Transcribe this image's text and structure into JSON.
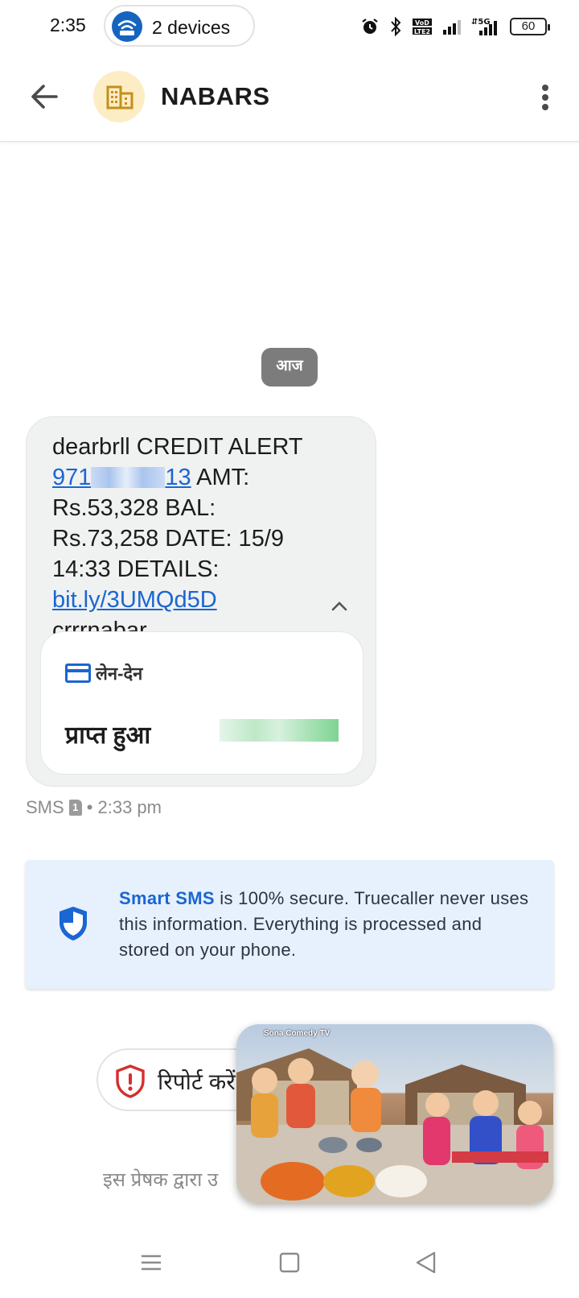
{
  "status_bar": {
    "time": "2:35",
    "devices_label": "2 devices",
    "battery": "60",
    "icons": [
      "alarm-icon",
      "bluetooth-icon",
      "volte-icon",
      "signal-icon",
      "5g-signal-icon",
      "battery-icon"
    ]
  },
  "app_bar": {
    "sender_name": "NABARS",
    "avatar_icon": "building-icon",
    "accent": "#fdedc5"
  },
  "conversation": {
    "date_chip": "आज",
    "message": {
      "line_prefix": "dearbrll CREDIT ALERT",
      "number_start": "971",
      "number_end": "13",
      "after_number": " AMT: Rs.53,328 BAL: Rs.73,258 DATE: 15/9 14:33 DETAILS: ",
      "link_text": "bit.ly/3UMQd5D",
      "suffix": " crrrnabar"
    },
    "transaction_card": {
      "header": "लेन-देन",
      "label": "प्राप्त हुआ"
    },
    "meta": {
      "channel": "SMS",
      "sim": "1",
      "time": "• 2:33 pm"
    }
  },
  "smart_sms": {
    "brand": "Smart SMS",
    "text": " is 100% secure. Truecaller never uses this information. Everything is processed and stored on your phone."
  },
  "report": {
    "label": "रिपोर्ट करें"
  },
  "footer": {
    "text": "इस प्रेषक द्वारा उ"
  },
  "pip": {
    "watermark": "Sona Comedy TV"
  },
  "colors": {
    "link": "#1a66d2",
    "bubble": "#f0f1f1",
    "smart_card": "#e7f0fd",
    "report_red": "#d32f2f"
  }
}
